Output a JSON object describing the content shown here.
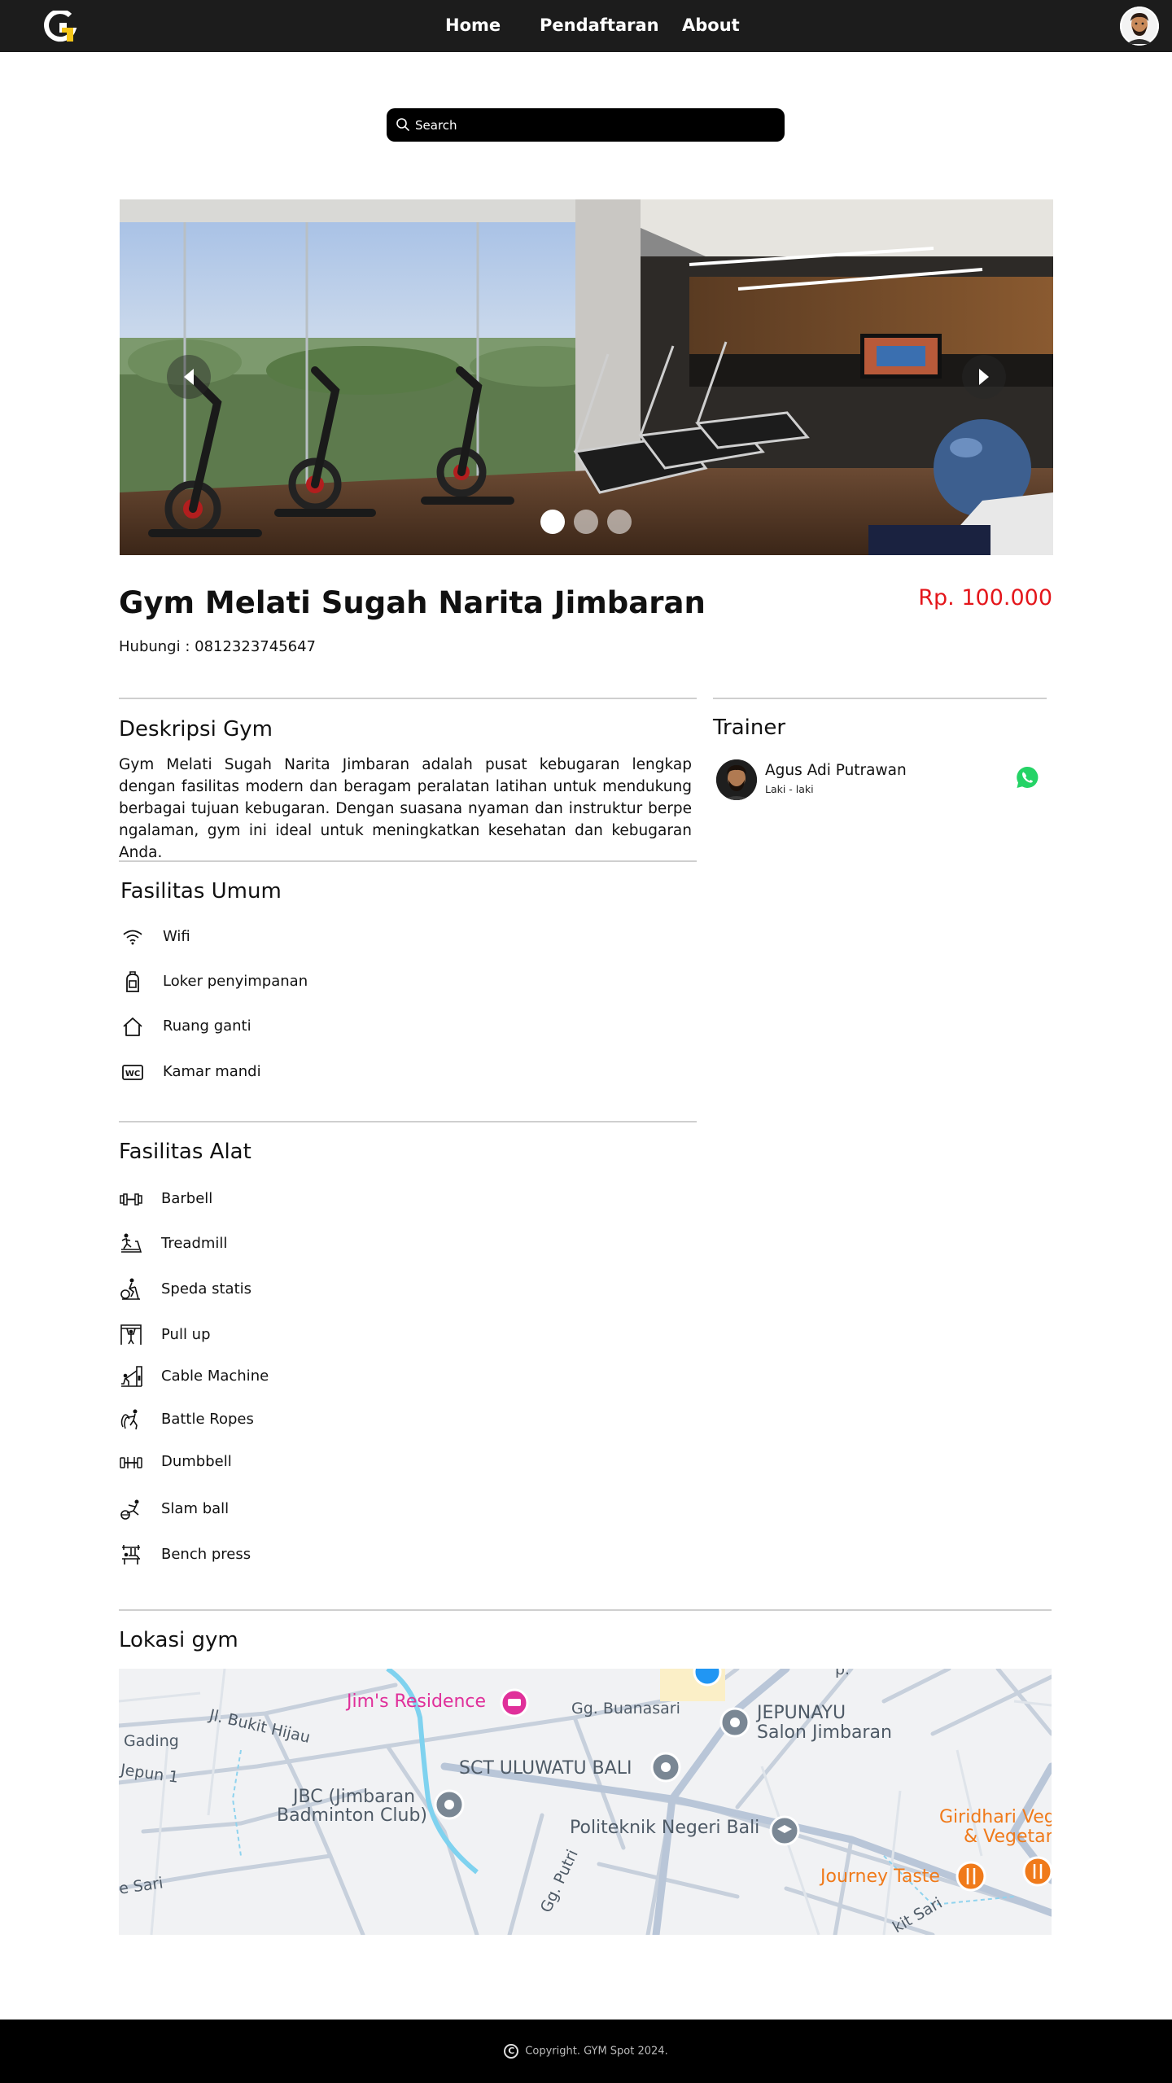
{
  "nav": {
    "links": [
      "Home",
      "Pendaftaran",
      "About"
    ]
  },
  "search": {
    "placeholder": "Search"
  },
  "carousel": {
    "slide_count": 3,
    "active_index": 0
  },
  "gym": {
    "title": "Gym Melati Sugah Narita Jimbaran",
    "contact": "Hubungi : 0812323745647",
    "price": "Rp. 100.000"
  },
  "description": {
    "heading": "Deskripsi Gym",
    "text": "Gym Melati Sugah Narita Jimbaran adalah pusat kebugaran lengkap dengan fasilitas modern dan beragam peralatan latihan untuk mendukung berbagai tujuan kebugaran. Dengan suasana nyaman dan instruktur berpe ngalaman, gym ini ideal untuk meningkatkan kesehatan dan kebugaran Anda."
  },
  "fasilitas_umum": {
    "heading": "Fasilitas Umum",
    "items": [
      {
        "label": "Wifi",
        "icon": "wifi-icon"
      },
      {
        "label": "Loker penyimpanan",
        "icon": "locker-icon"
      },
      {
        "label": "Ruang ganti",
        "icon": "house-icon"
      },
      {
        "label": "Kamar mandi",
        "icon": "wc-icon"
      }
    ]
  },
  "fasilitas_alat": {
    "heading": "Fasilitas Alat",
    "items": [
      {
        "label": "Barbell",
        "icon": "barbell-icon"
      },
      {
        "label": "Treadmill",
        "icon": "treadmill-icon"
      },
      {
        "label": "Speda statis",
        "icon": "stationary-bike-icon"
      },
      {
        "label": "Pull up",
        "icon": "pull-up-icon"
      },
      {
        "label": "Cable Machine",
        "icon": "cable-machine-icon"
      },
      {
        "label": "Battle Ropes",
        "icon": "battle-ropes-icon"
      },
      {
        "label": "Dumbbell",
        "icon": "dumbbell-icon"
      },
      {
        "label": "Slam ball",
        "icon": "slam-ball-icon"
      },
      {
        "label": "Bench press",
        "icon": "bench-press-icon"
      }
    ]
  },
  "trainer": {
    "heading": "Trainer",
    "name": "Agus Adi Putrawan",
    "gender": "Laki - laki",
    "contact_icon": "whatsapp-icon"
  },
  "location": {
    "heading": "Lokasi gym",
    "map_labels": {
      "jims": "Jim's Residence",
      "buanasari": "Gg. Buanasari",
      "jepunayu_1": "JEPUNAYU",
      "jepunayu_2": "Salon Jimbaran",
      "bukit_hijau": "Jl. Bukit Hijau",
      "gading": "Gading",
      "jepun": "Jepun 1",
      "sct": "SCT ULUWATU BALI",
      "jbc_1": "JBC (Jimbaran",
      "jbc_2": "Badminton Club)",
      "politeknik": "Politeknik Negeri Bali",
      "giridhari_1": "Giridhari Veg",
      "giridhari_2": "& Vegetar",
      "journey": "Journey Taste",
      "putri": "Gg. Putri",
      "sari": "e Sari",
      "kit_sari": "kit Sari",
      "p": "p."
    }
  },
  "footer": {
    "copyright": "Copyright. GYM Spot 2024."
  },
  "colors": {
    "nav_bg": "#1c1c1c",
    "logo_yellow": "#f5c518",
    "price_red": "#e4161b",
    "whatsapp_green": "#25d366",
    "map_pink": "#e0309a",
    "map_orange": "#f07a1a"
  }
}
